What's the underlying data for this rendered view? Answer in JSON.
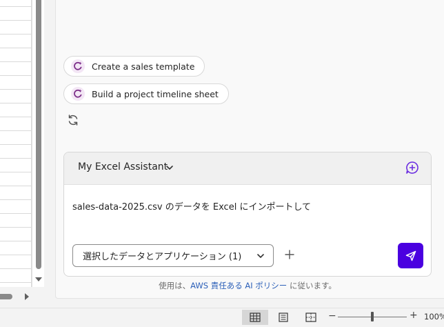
{
  "suggestions": [
    {
      "label": "Create a sales template"
    },
    {
      "label": "Build a project timeline sheet"
    }
  ],
  "assistant": {
    "name": "My Excel Assistant",
    "prompt_text": "sales-data-2025.csv のデータを Excel にインポートして",
    "context_button_label": "選択したデータとアプリケーション (1)"
  },
  "policy": {
    "prefix": "使用は、",
    "link_text": "AWS 責任ある AI ポリシー",
    "suffix": " に従います。"
  },
  "statusbar": {
    "zoom_minus": "−",
    "zoom_plus": "+",
    "zoom_level": "100%"
  },
  "colors": {
    "send_button": "#4a00e0",
    "suggestion_icon": "#7a2a87",
    "new_chat_icon": "#6a2de0",
    "policy_link": "#2b5fb8"
  },
  "icons": {
    "suggestion": "sparkle-refresh-icon",
    "refresh": "refresh-icon",
    "new_chat": "new-chat-icon",
    "send": "send-icon"
  }
}
